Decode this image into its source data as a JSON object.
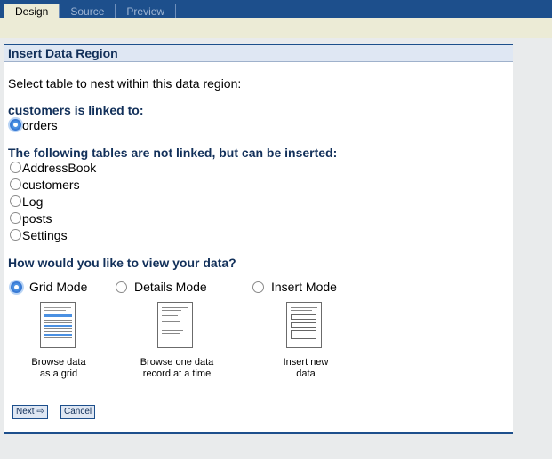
{
  "tabs": [
    {
      "label": "Design"
    },
    {
      "label": "Source"
    },
    {
      "label": "Preview"
    }
  ],
  "panel": {
    "title": "Insert Data Region",
    "instruction": "Select table to nest within this data region:",
    "linked_header": "customers is linked to:",
    "linked_options": [
      {
        "label": "orders",
        "selected": true
      }
    ],
    "unlinked_header": "The following tables are not linked, but can be inserted:",
    "unlinked_options": [
      {
        "label": "AddressBook"
      },
      {
        "label": "customers"
      },
      {
        "label": "Log"
      },
      {
        "label": "posts"
      },
      {
        "label": "Settings"
      }
    ],
    "view_header": "How would you like to view your data?",
    "modes": [
      {
        "label": "Grid Mode",
        "selected": true,
        "caption_1": "Browse data",
        "caption_2": "as a grid"
      },
      {
        "label": "Details Mode",
        "selected": false,
        "caption_1": "Browse one data",
        "caption_2": "record at a time"
      },
      {
        "label": "Insert Mode",
        "selected": false,
        "caption_1": "Insert new",
        "caption_2": "data"
      }
    ],
    "next_label": "Next ⇨",
    "cancel_label": "Cancel"
  },
  "colors": {
    "accent": "#1d4f8c",
    "title_bg": "#dfe7f3",
    "selected_radio": "#4a90e2"
  }
}
